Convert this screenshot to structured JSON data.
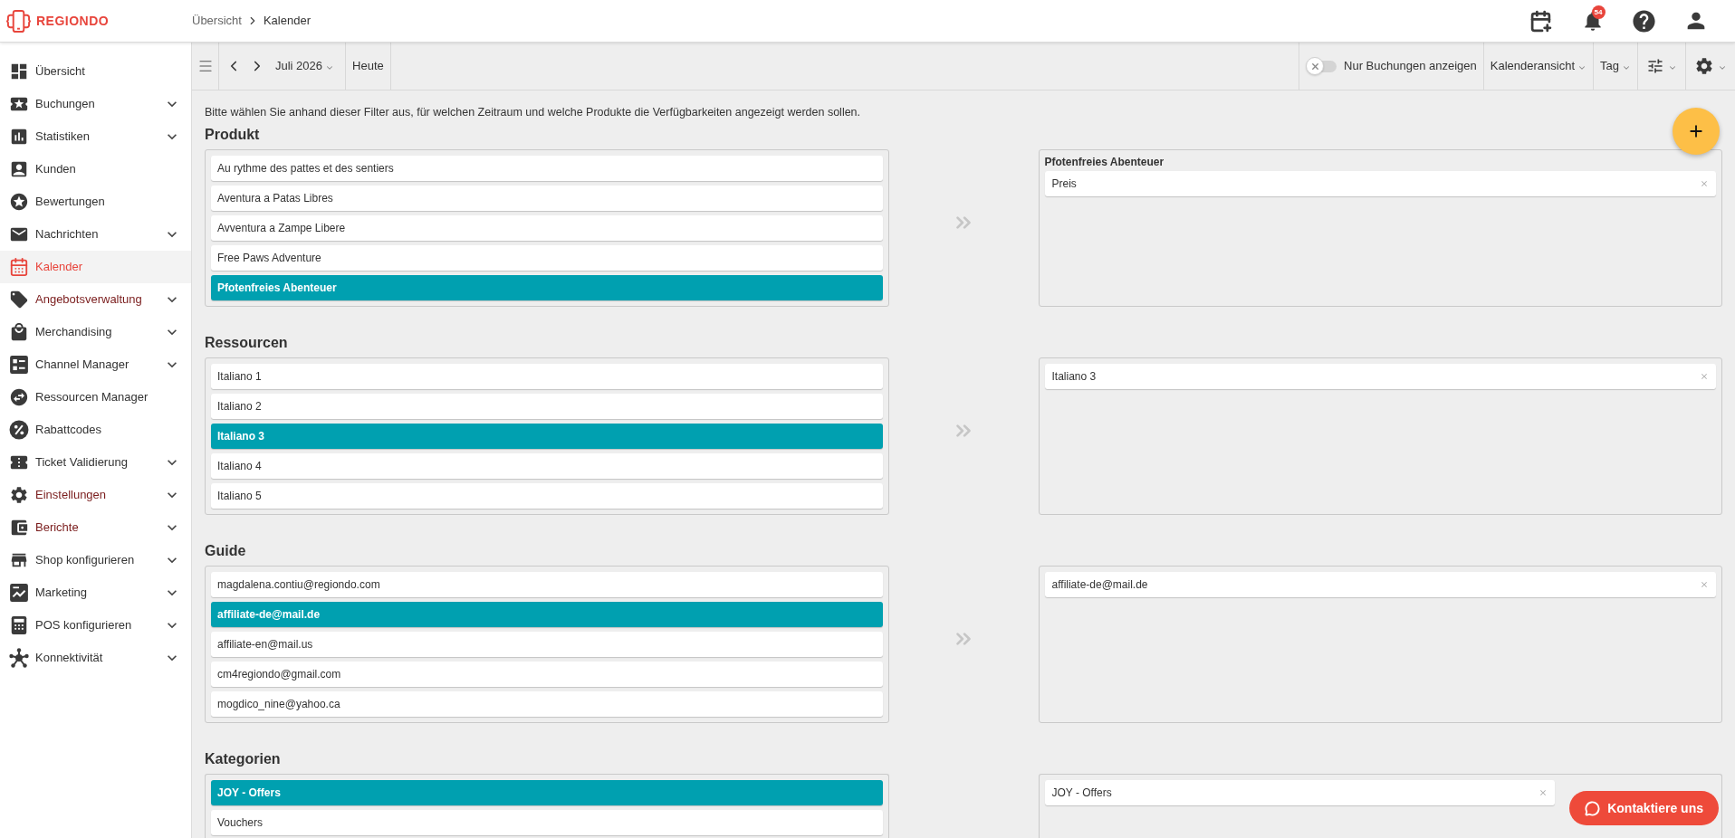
{
  "header": {
    "logo": "REGIONDO",
    "breadcrumb": [
      "Übersicht",
      "Kalender"
    ],
    "notification_count": "54"
  },
  "sidebar": {
    "items": [
      {
        "label": "Übersicht",
        "kind": "link",
        "selected": false,
        "highlighted": false
      },
      {
        "label": "Buchungen",
        "kind": "group",
        "selected": false,
        "highlighted": false
      },
      {
        "label": "Statistiken",
        "kind": "group",
        "selected": false,
        "highlighted": false
      },
      {
        "label": "Kunden",
        "kind": "link",
        "selected": false,
        "highlighted": false
      },
      {
        "label": "Bewertungen",
        "kind": "link",
        "selected": false,
        "highlighted": false
      },
      {
        "label": "Nachrichten",
        "kind": "group",
        "selected": false,
        "highlighted": false
      },
      {
        "label": "Kalender",
        "kind": "link",
        "selected": true,
        "highlighted": false
      },
      {
        "label": "Angebotsverwaltung",
        "kind": "group",
        "selected": false,
        "highlighted": true
      },
      {
        "label": "Merchandising",
        "kind": "group",
        "selected": false,
        "highlighted": false
      },
      {
        "label": "Channel Manager",
        "kind": "group",
        "selected": false,
        "highlighted": false
      },
      {
        "label": "Ressourcen Manager",
        "kind": "link",
        "selected": false,
        "highlighted": false
      },
      {
        "label": "Rabattcodes",
        "kind": "link",
        "selected": false,
        "highlighted": false
      },
      {
        "label": "Ticket Validierung",
        "kind": "group",
        "selected": false,
        "highlighted": false
      },
      {
        "label": "Einstellungen",
        "kind": "group",
        "selected": false,
        "highlighted": true
      },
      {
        "label": "Berichte",
        "kind": "group",
        "selected": false,
        "highlighted": true
      },
      {
        "label": "Shop konfigurieren",
        "kind": "group",
        "selected": false,
        "highlighted": false
      },
      {
        "label": "Marketing",
        "kind": "group",
        "selected": false,
        "highlighted": false
      },
      {
        "label": "POS konfigurieren",
        "kind": "group",
        "selected": false,
        "highlighted": false
      },
      {
        "label": "Konnektivität",
        "kind": "group",
        "selected": false,
        "highlighted": false
      }
    ]
  },
  "toolbar": {
    "month": "Juli 2026",
    "today": "Heute",
    "bookings_toggle": {
      "label": "Nur Buchungen anzeigen",
      "on": false
    },
    "view": "Kalenderansicht",
    "range": "Tag"
  },
  "instructions": "Bitte wählen Sie anhand dieser Filter aus, für welchen Zeitraum und welche Produkte die Verfügbarkeiten angezeigt werden sollen.",
  "sections": [
    {
      "title": "Produkt",
      "options": [
        {
          "label": "Au rythme des pattes et des sentiers",
          "selected": false
        },
        {
          "label": "Aventura a Patas Libres",
          "selected": false
        },
        {
          "label": "Avventura a Zampe Libere",
          "selected": false
        },
        {
          "label": "Free Paws Adventure",
          "selected": false
        },
        {
          "label": "Pfotenfreies Abenteuer",
          "selected": true
        }
      ],
      "chosen": {
        "heading": "Pfotenfreies Abenteuer",
        "items": [
          "Preis"
        ]
      }
    },
    {
      "title": "Ressourcen",
      "options": [
        {
          "label": "Italiano 1",
          "selected": false
        },
        {
          "label": "Italiano 2",
          "selected": false
        },
        {
          "label": "Italiano 3",
          "selected": true
        },
        {
          "label": "Italiano 4",
          "selected": false
        },
        {
          "label": "Italiano 5",
          "selected": false
        }
      ],
      "chosen": {
        "items": [
          "Italiano 3"
        ]
      }
    },
    {
      "title": "Guide",
      "options": [
        {
          "label": "magdalena.contiu@regiondo.com",
          "selected": false
        },
        {
          "label": "affiliate-de@mail.de",
          "selected": true
        },
        {
          "label": "affiliate-en@mail.us",
          "selected": false
        },
        {
          "label": "cm4regiondo@gmail.com",
          "selected": false
        },
        {
          "label": "mogdico_nine@yahoo.ca",
          "selected": false
        }
      ],
      "chosen": {
        "items": [
          "affiliate-de@mail.de"
        ]
      }
    },
    {
      "title": "Kategorien",
      "options": [
        {
          "label": "JOY - Offers",
          "selected": true
        },
        {
          "label": "Vouchers",
          "selected": false
        }
      ],
      "chosen": {
        "items": [
          "JOY - Offers"
        ]
      }
    }
  ],
  "contact_button": "Kontaktiere uns"
}
